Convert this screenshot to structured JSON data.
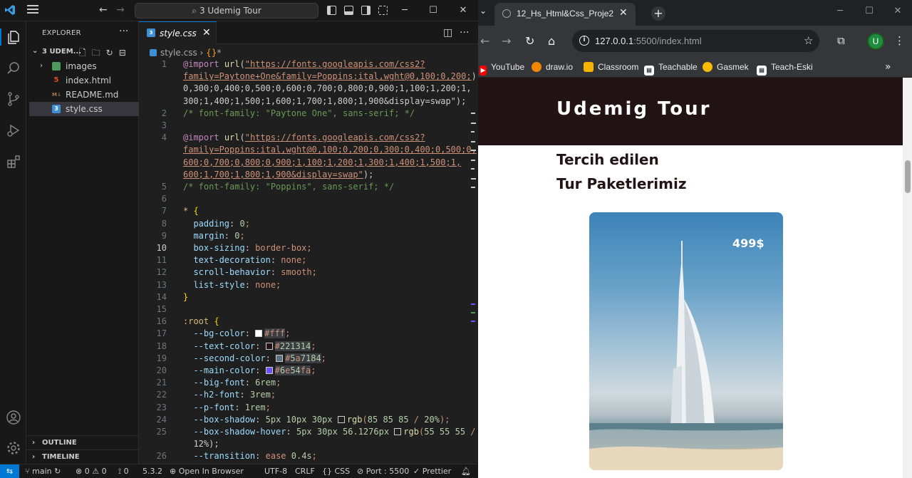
{
  "vscode": {
    "search": "3 Udemig Tour",
    "explorer": {
      "title": "EXPLORER",
      "folder": "3 UDEM...",
      "items": [
        {
          "label": "images"
        },
        {
          "label": "index.html"
        },
        {
          "label": "README.md"
        },
        {
          "label": "style.css"
        }
      ],
      "outline": "OUTLINE",
      "timeline": "TIMELINE"
    },
    "tab": {
      "label": "style.css"
    },
    "breadcrumb": {
      "file": "style.css",
      "symbol": "*"
    },
    "code_lines": [
      {
        "n": "1",
        "t": "@import url(\"https://fonts.googleapis.com/css2?"
      },
      {
        "n": "",
        "t": "family=Paytone+One&family=Poppins:ital,wght@0,100;0,200;"
      },
      {
        "n": "",
        "t": "0,300;0,400;0,500;0,600;0,700;0,800;0,900;1,100;1,200;1,"
      },
      {
        "n": "",
        "t": "300;1,400;1,500;1,600;1,700;1,800;1,900&display=swap\");"
      },
      {
        "n": "2",
        "t": "/* font-family: \"Paytone One\", sans-serif; */"
      },
      {
        "n": "3",
        "t": ""
      },
      {
        "n": "4",
        "t": "@import url(\"https://fonts.googleapis.com/css2?"
      },
      {
        "n": "",
        "t": "family=Poppins:ital,wght@0,100;0,200;0,300;0,400;0,500;0,"
      },
      {
        "n": "",
        "t": "600;0,700;0,800;0,900;1,100;1,200;1,300;1,400;1,500;1,"
      },
      {
        "n": "",
        "t": "600;1,700;1,800;1,900&display=swap\");"
      },
      {
        "n": "5",
        "t": "/* font-family: \"Poppins\", sans-serif; */"
      },
      {
        "n": "6",
        "t": ""
      },
      {
        "n": "7",
        "t": "* {"
      },
      {
        "n": "8",
        "t": "  padding: 0;"
      },
      {
        "n": "9",
        "t": "  margin: 0;"
      },
      {
        "n": "10",
        "t": "  box-sizing: border-box;"
      },
      {
        "n": "11",
        "t": "  text-decoration: none;"
      },
      {
        "n": "12",
        "t": "  scroll-behavior: smooth;"
      },
      {
        "n": "13",
        "t": "  list-style: none;"
      },
      {
        "n": "14",
        "t": "}"
      },
      {
        "n": "15",
        "t": ""
      },
      {
        "n": "16",
        "t": ":root {"
      },
      {
        "n": "17",
        "t": "  --bg-color: #fff;"
      },
      {
        "n": "18",
        "t": "  --text-color: #221314;"
      },
      {
        "n": "19",
        "t": "  --second-color: #5a7184;"
      },
      {
        "n": "20",
        "t": "  --main-color: #6e54fa;"
      },
      {
        "n": "21",
        "t": "  --big-font: 6rem;"
      },
      {
        "n": "22",
        "t": "  --h2-font: 3rem;"
      },
      {
        "n": "23",
        "t": "  --p-font: 1rem;"
      },
      {
        "n": "24",
        "t": "  --box-shadow: 5px 10px 30px rgb(85 85 85 / 20%);"
      },
      {
        "n": "25",
        "t": "  --box-shadow-hover: 5px 30px 56.1276px rgb(55 55 55 /"
      },
      {
        "n": "",
        "t": "  12%);"
      },
      {
        "n": "26",
        "t": "  --transition: ease 0.4s;"
      }
    ],
    "status": {
      "branch": "main",
      "errors": "0",
      "warnings": "0",
      "ports_count": "0",
      "version": "5.3.2",
      "open_browser": "Open In Browser",
      "encoding": "UTF-8",
      "eol": "CRLF",
      "language": "CSS",
      "port": "Port : 5500",
      "prettier": "Prettier"
    }
  },
  "chrome": {
    "tab_title": "12_Hs_Html&Css_Proje2",
    "url_host": "127.0.0.1",
    "url_path": ":5500/index.html",
    "avatar": "U",
    "bookmarks": [
      {
        "label": "YouTube",
        "color": "#ff0000"
      },
      {
        "label": "draw.io",
        "color": "#f08705"
      },
      {
        "label": "Classroom",
        "color": "#f4b400"
      },
      {
        "label": "Teachable",
        "color": "#ffffff"
      },
      {
        "label": "Gasmek",
        "color": "#fbbc04"
      },
      {
        "label": "Teach-Eski",
        "color": "#ffffff"
      }
    ]
  },
  "site": {
    "title": "Udemig Tour",
    "subtitle_line1": "Tercih edilen",
    "subtitle_line2": "Tur Paketlerimiz",
    "card_price": "499$"
  }
}
